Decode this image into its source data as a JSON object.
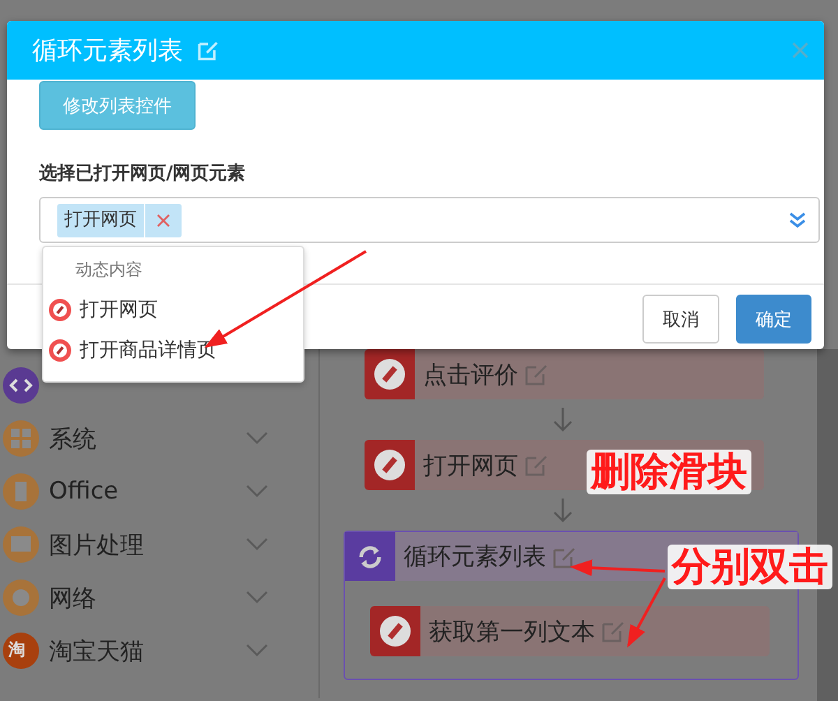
{
  "dialog": {
    "title": "循环元素列表",
    "edit_list_button": "修改列表控件",
    "field_label": "选择已打开网页/网页元素",
    "select": {
      "tags": [
        {
          "label": "打开网页"
        }
      ]
    },
    "buttons": [
      {
        "label": "取消",
        "kind": "default"
      },
      {
        "label": "确定",
        "kind": "primary"
      }
    ]
  },
  "dropdown": {
    "group_label": "动态内容",
    "options": [
      {
        "label": "打开网页"
      },
      {
        "label": "打开商品详情页"
      }
    ]
  },
  "sidebar": {
    "items": [
      {
        "kind": "code"
      },
      {
        "kind": "system",
        "label": "系统"
      },
      {
        "kind": "office",
        "label": "Office"
      },
      {
        "kind": "image",
        "label": "图片处理"
      },
      {
        "kind": "network",
        "label": "网络"
      },
      {
        "kind": "shop",
        "label": "淘宝天猫",
        "icon_text": "淘"
      }
    ]
  },
  "workflow": {
    "steps": [
      {
        "kind": "action",
        "label": "点击评价"
      },
      {
        "kind": "action",
        "label": "打开网页"
      },
      {
        "kind": "loop",
        "label": "循环元素列表",
        "children": [
          {
            "kind": "action",
            "label": "获取第一列文本"
          }
        ]
      }
    ]
  },
  "annotations": [
    {
      "text": "删除滑块"
    },
    {
      "text": "分别双击"
    }
  ]
}
